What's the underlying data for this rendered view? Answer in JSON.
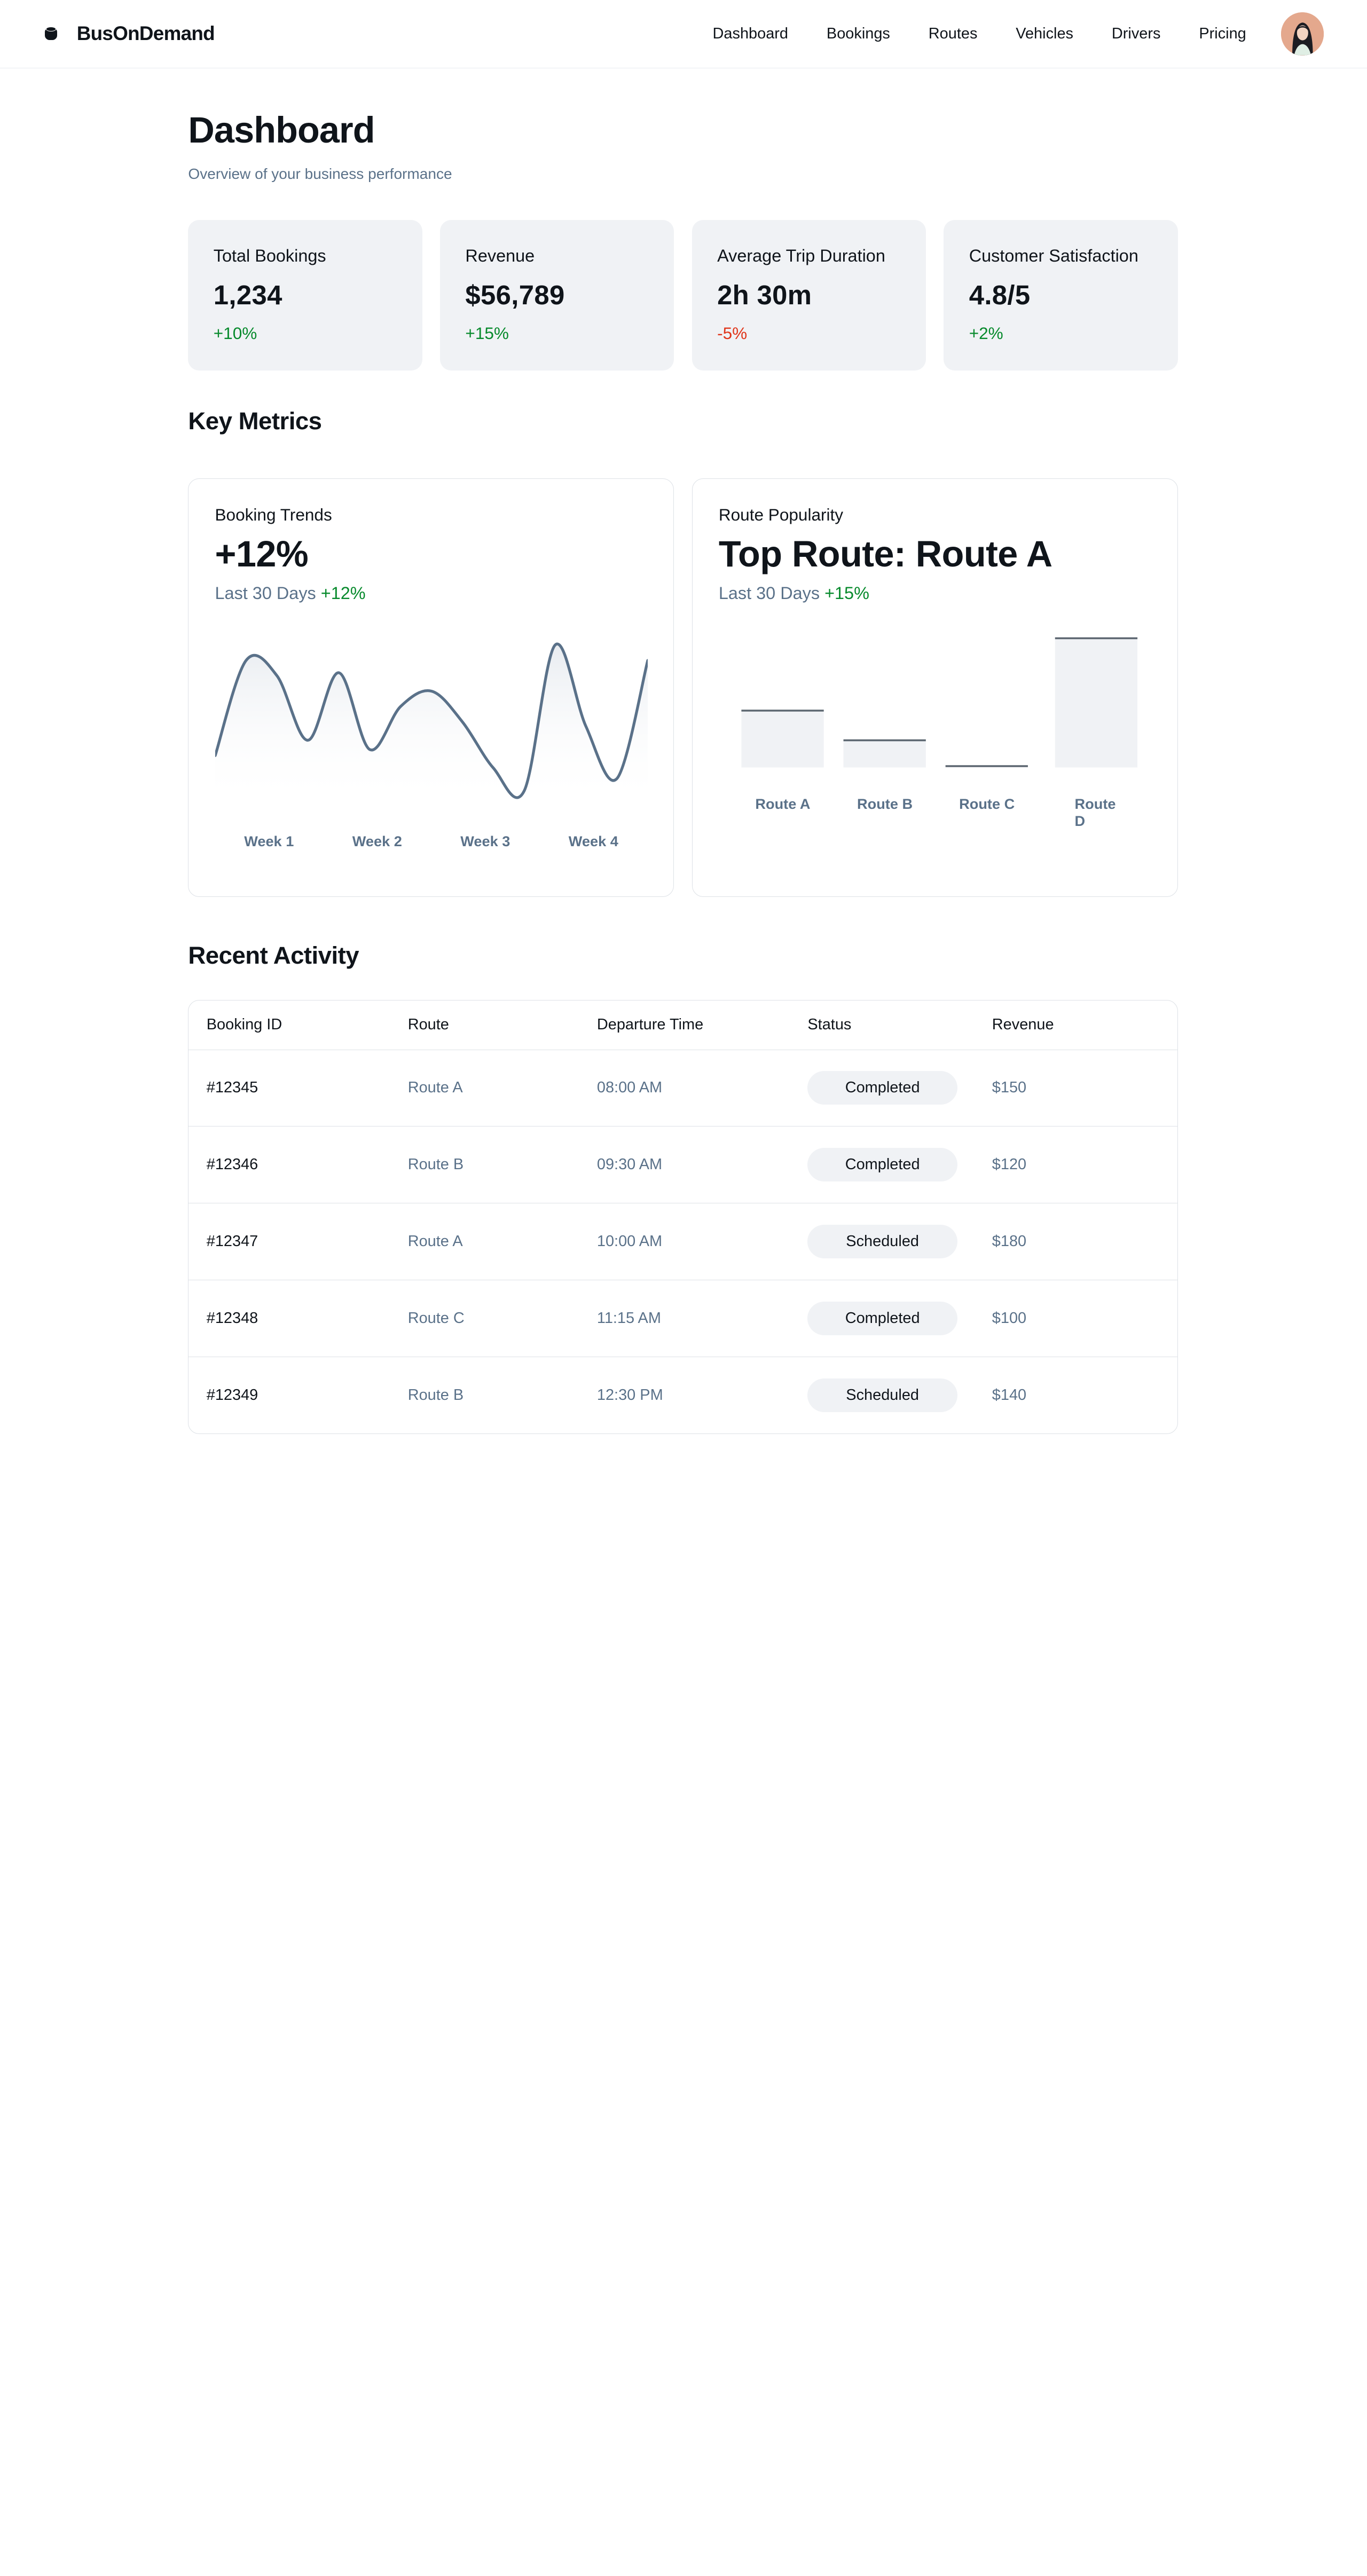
{
  "app": {
    "name": "BusOnDemand",
    "nav": [
      "Dashboard",
      "Bookings",
      "Routes",
      "Vehicles",
      "Drivers",
      "Pricing"
    ]
  },
  "header": {
    "title": "Dashboard",
    "subtitle": "Overview of your business performance"
  },
  "stats": [
    {
      "label": "Total Bookings",
      "value": "1,234",
      "change": "+10%",
      "trend": "up"
    },
    {
      "label": "Revenue",
      "value": "$56,789",
      "change": "+15%",
      "trend": "up"
    },
    {
      "label": "Average Trip Duration",
      "value": "2h 30m",
      "change": "-5%",
      "trend": "down"
    },
    {
      "label": "Customer Satisfaction",
      "value": "4.8/5",
      "change": "+2%",
      "trend": "up"
    }
  ],
  "sections": {
    "key_metrics": "Key Metrics",
    "recent_activity": "Recent Activity"
  },
  "booking_trends": {
    "label": "Booking Trends",
    "value": "+12%",
    "period": "Last 30 Days",
    "change": "+12%"
  },
  "route_popularity": {
    "label": "Route Popularity",
    "value": "Top Route: Route A",
    "period": "Last 30 Days",
    "change": "+15%"
  },
  "chart_data": [
    {
      "type": "line",
      "title": "",
      "x_labels": [
        "Week 1",
        "Week 2",
        "Week 3",
        "Week 4"
      ],
      "series": [
        {
          "values": [
            0.26,
            0.88,
            0.78,
            0.36,
            0.8,
            0.3,
            0.58,
            0.68,
            0.48,
            0.18,
            0.03,
            0.98,
            0.45,
            0.11,
            0.88
          ]
        }
      ],
      "ylim": [
        0,
        1
      ],
      "grid": false,
      "color": "#5a7189"
    },
    {
      "type": "bar",
      "title": "",
      "categories": [
        "Route A",
        "Route B",
        "Route C",
        "Route D"
      ],
      "values": [
        44,
        21,
        1,
        100
      ],
      "ylim": [
        0,
        100
      ],
      "grid": false
    }
  ],
  "table": {
    "headers": [
      "Booking ID",
      "Route",
      "Departure Time",
      "Status",
      "Revenue"
    ],
    "rows": [
      {
        "id": "#12345",
        "route": "Route A",
        "time": "08:00 AM",
        "status": "Completed",
        "revenue": "$150"
      },
      {
        "id": "#12346",
        "route": "Route B",
        "time": "09:30 AM",
        "status": "Completed",
        "revenue": "$120"
      },
      {
        "id": "#12347",
        "route": "Route A",
        "time": "10:00 AM",
        "status": "Scheduled",
        "revenue": "$180"
      },
      {
        "id": "#12348",
        "route": "Route C",
        "time": "11:15 AM",
        "status": "Completed",
        "revenue": "$100"
      },
      {
        "id": "#12349",
        "route": "Route B",
        "time": "12:30 PM",
        "status": "Scheduled",
        "revenue": "$140"
      }
    ]
  },
  "colors": {
    "positive": "#078a2c",
    "negative": "#e0361b",
    "muted": "#5a7189",
    "card_bg": "#f0f2f5"
  }
}
